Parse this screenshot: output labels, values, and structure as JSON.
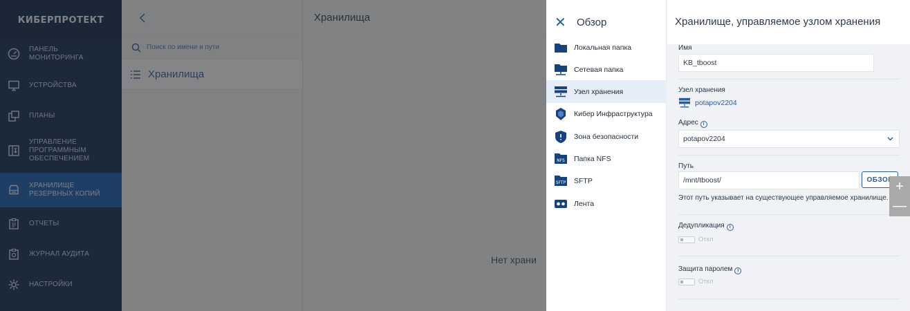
{
  "nav": {
    "brand": "КИБЕРПРОТЕКТ",
    "items": [
      {
        "label": "ПАНЕЛЬ\nМОНИТОРИНГА",
        "icon": "gauge-icon"
      },
      {
        "label": "УСТРОЙСТВА",
        "icon": "monitor-icon"
      },
      {
        "label": "ПЛАНЫ",
        "icon": "plans-icon"
      },
      {
        "label": "УПРАВЛЕНИЕ\nПРОГРАММНЫМ\nОБЕСПЕЧЕНИЕМ",
        "icon": "software-icon"
      },
      {
        "label": "ХРАНИЛИЩЕ\nРЕЗЕРВНЫХ КОПИЙ",
        "icon": "storage-icon"
      },
      {
        "label": "ОТЧЕТЫ",
        "icon": "reports-icon"
      },
      {
        "label": "ЖУРНАЛ АУДИТА",
        "icon": "audit-icon"
      },
      {
        "label": "НАСТРОЙКИ",
        "icon": "gear-icon"
      }
    ],
    "active_index": 4
  },
  "list_panel": {
    "search_placeholder": "Поиск по имени и пути",
    "node_label": "Хранилища"
  },
  "main": {
    "title": "Хранилища",
    "empty_text": "Нет храни"
  },
  "types_panel": {
    "close_icon": "close-icon",
    "title": "Обзор",
    "items": [
      {
        "label": "Локальная папка",
        "icon": "folder-icon"
      },
      {
        "label": "Сетевая папка",
        "icon": "network-folder-icon"
      },
      {
        "label": "Узел хранения",
        "icon": "storage-node-icon"
      },
      {
        "label": "Кибер Инфраструктура",
        "icon": "infrastructure-icon"
      },
      {
        "label": "Зона безопасности",
        "icon": "shield-icon"
      },
      {
        "label": "Папка NFS",
        "icon": "nfs-icon"
      },
      {
        "label": "SFTP",
        "icon": "sftp-icon"
      },
      {
        "label": "Лента",
        "icon": "tape-icon"
      }
    ],
    "selected_index": 2
  },
  "form": {
    "title": "Хранилище, управляемое узлом хранения",
    "name_label": "Имя",
    "name_value": "KB_tboost",
    "node_label": "Узел хранения",
    "node_value": "potapov2204",
    "address_label": "Адрес",
    "address_value": "potapov2204",
    "path_label": "Путь",
    "path_value": "/mnt/tboost/",
    "browse_label": "ОБЗОР",
    "path_hint": "Этот путь указывает на существующее управляемое хранилище.",
    "dedup_label": "Дедупликация",
    "dedup_state": "Откл",
    "password_label": "Защита паролем",
    "password_state": "Откл"
  },
  "colors": {
    "nav_bg": "#0f2a52",
    "nav_active": "#155ab0",
    "accent": "#2a5d9c",
    "selected_row": "#e4edf8"
  },
  "zoom": {
    "plus": "+",
    "minus": "—"
  }
}
